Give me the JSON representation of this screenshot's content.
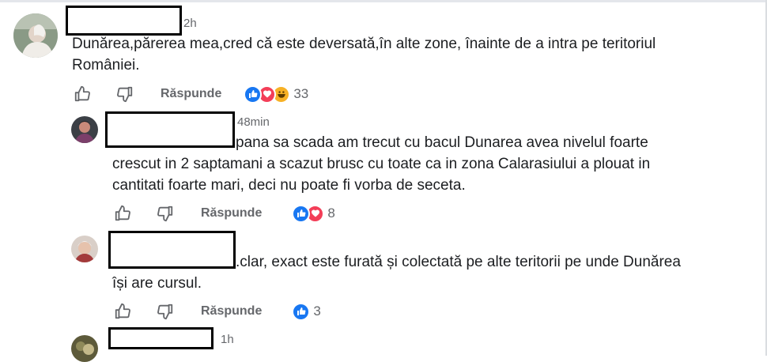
{
  "comments": [
    {
      "time": "2h",
      "text_line1": "Dunărea,părerea mea,cred că este deversată,în alte zone, înainte de a intra pe teritoriul",
      "text_line2": "României.",
      "reply_label": "Răspunde",
      "reaction_count": "33",
      "reactions": [
        "like-icon",
        "love-icon",
        "haha-icon"
      ]
    },
    {
      "time": "48min",
      "text_line1": "pana sa scada am trecut cu bacul Dunarea avea nivelul foarte",
      "text_line2": "crescut in 2 saptamani a scazut brusc cu toate ca in zona Calarasiului a plouat in",
      "text_line3": "cantitati foarte mari, deci nu poate fi vorba de seceta.",
      "reply_label": "Răspunde",
      "reaction_count": "8",
      "reactions": [
        "like-icon",
        "love-icon"
      ]
    },
    {
      "time": "",
      "text_line1": ".clar, exact este furată și colectată pe alte teritorii pe unde Dunărea",
      "text_line2": "își are cursul.",
      "reply_label": "Răspunde",
      "reaction_count": "3",
      "reactions": [
        "like-icon"
      ]
    },
    {
      "time": "1h"
    }
  ],
  "colors": {
    "like": "#1877f2",
    "love": "#f33e58",
    "haha": "#f7b125",
    "muted": "#65676b"
  }
}
